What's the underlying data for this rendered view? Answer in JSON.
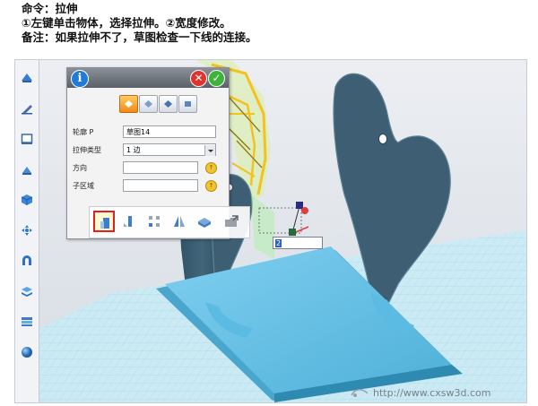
{
  "caption": {
    "line1": "命令：拉伸",
    "line2": "①左键单击物体，选择拉伸。②宽度修改。",
    "line3": "备注：如果拉伸不了，草图检查一下线的连接。"
  },
  "toolbar": {
    "items": [
      {
        "name": "view-icon"
      },
      {
        "name": "sketch-icon"
      },
      {
        "name": "sketch-plane-icon"
      },
      {
        "name": "feature-icon"
      },
      {
        "name": "solid-cube-icon"
      },
      {
        "name": "transform-icon"
      },
      {
        "name": "magnet-icon"
      },
      {
        "name": "layers-icon"
      },
      {
        "name": "panels-icon"
      },
      {
        "name": "sphere-icon"
      }
    ]
  },
  "dialog": {
    "fields": {
      "profile_label": "轮廓 P",
      "profile_value": "草图14",
      "type_label": "拉伸类型",
      "type_value": "1 边",
      "direction_label": "方向",
      "direction_value": "",
      "subregion_label": "子区域",
      "subregion_value": ""
    },
    "modes": [
      "new-body-icon",
      "add-icon",
      "subtract-icon",
      "intersect-icon"
    ]
  },
  "mini_toolbar": {
    "items": [
      {
        "name": "extrude-icon",
        "selected": true
      },
      {
        "name": "revolve-icon"
      },
      {
        "name": "pattern-icon"
      },
      {
        "name": "mirror-icon"
      },
      {
        "name": "shell-icon"
      },
      {
        "name": "export-icon"
      }
    ]
  },
  "length_input": {
    "value": ""
  },
  "watermark": "http://www.cxsw3d.com",
  "colors": {
    "model": "#3e5f73",
    "model_dark": "#2b4556",
    "base": "#57b8de",
    "base_light": "#87d2ee",
    "grid": "#8fd3ea",
    "highlight": "#f3c21e",
    "selection": "#e02020"
  }
}
